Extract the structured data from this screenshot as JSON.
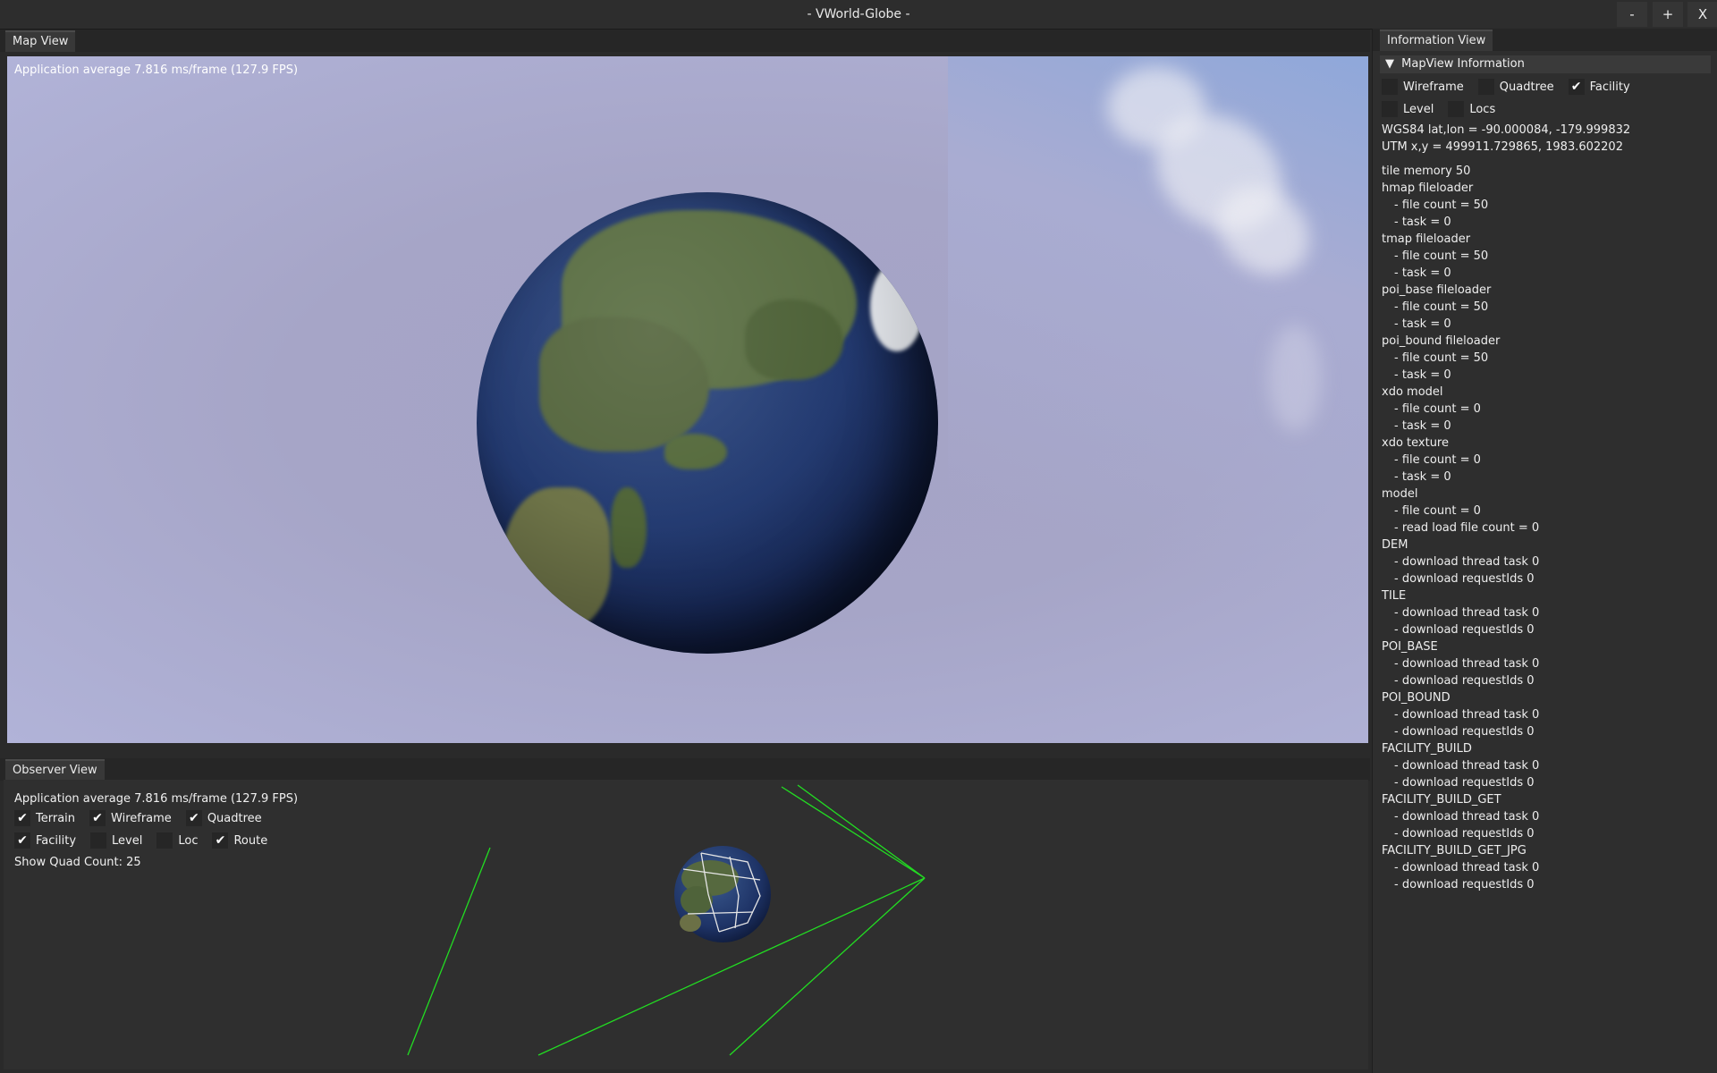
{
  "window": {
    "title": "- VWorld-Globe -",
    "minimize_label": "-",
    "maximize_label": "+",
    "close_label": "X"
  },
  "map_view": {
    "tab": "Map View",
    "fps_text": "Application average 7.816 ms/frame (127.9 FPS)"
  },
  "observer_view": {
    "tab": "Observer View",
    "fps_text": "Application average 7.816 ms/frame (127.9 FPS)",
    "checkboxes_row1": [
      {
        "label": "Terrain",
        "checked": true
      },
      {
        "label": "Wireframe",
        "checked": true
      },
      {
        "label": "Quadtree",
        "checked": true
      }
    ],
    "checkboxes_row2": [
      {
        "label": "Facility",
        "checked": true
      },
      {
        "label": "Level",
        "checked": false
      },
      {
        "label": "Loc",
        "checked": false
      },
      {
        "label": "Route",
        "checked": true
      }
    ],
    "quad_count_text": "Show Quad Count: 25"
  },
  "info_view": {
    "tab": "Information View",
    "section_title": "MapView Information",
    "checkboxes_row1": [
      {
        "label": "Wireframe",
        "checked": false
      },
      {
        "label": "Quadtree",
        "checked": false
      },
      {
        "label": "Facility",
        "checked": true
      }
    ],
    "checkboxes_row2": [
      {
        "label": "Level",
        "checked": false
      },
      {
        "label": "Locs",
        "checked": false
      }
    ],
    "wgs84": "WGS84 lat,lon = -90.000084, -179.999832",
    "utm": "UTM x,y = 499911.729865, 1983.602202",
    "lines": [
      {
        "text": "tile memory 50",
        "sub": false
      },
      {
        "text": "hmap fileloader",
        "sub": false
      },
      {
        "text": "- file count = 50",
        "sub": true
      },
      {
        "text": "- task = 0",
        "sub": true
      },
      {
        "text": "tmap fileloader",
        "sub": false
      },
      {
        "text": "- file count = 50",
        "sub": true
      },
      {
        "text": "- task = 0",
        "sub": true
      },
      {
        "text": "poi_base fileloader",
        "sub": false
      },
      {
        "text": "- file count = 50",
        "sub": true
      },
      {
        "text": "- task = 0",
        "sub": true
      },
      {
        "text": "poi_bound fileloader",
        "sub": false
      },
      {
        "text": "- file count = 50",
        "sub": true
      },
      {
        "text": "- task = 0",
        "sub": true
      },
      {
        "text": "xdo model",
        "sub": false
      },
      {
        "text": "- file count = 0",
        "sub": true
      },
      {
        "text": "- task = 0",
        "sub": true
      },
      {
        "text": "xdo texture",
        "sub": false
      },
      {
        "text": "- file count = 0",
        "sub": true
      },
      {
        "text": "- task = 0",
        "sub": true
      },
      {
        "text": "model",
        "sub": false
      },
      {
        "text": "- file count = 0",
        "sub": true
      },
      {
        "text": "- read load file count = 0",
        "sub": true
      },
      {
        "text": "DEM",
        "sub": false
      },
      {
        "text": "- download thread task 0",
        "sub": true
      },
      {
        "text": "- download requestIds 0",
        "sub": true
      },
      {
        "text": "TILE",
        "sub": false
      },
      {
        "text": "- download thread task 0",
        "sub": true
      },
      {
        "text": "- download requestIds 0",
        "sub": true
      },
      {
        "text": "POI_BASE",
        "sub": false
      },
      {
        "text": "- download thread task 0",
        "sub": true
      },
      {
        "text": "- download requestIds 0",
        "sub": true
      },
      {
        "text": "POI_BOUND",
        "sub": false
      },
      {
        "text": "- download thread task 0",
        "sub": true
      },
      {
        "text": "- download requestIds 0",
        "sub": true
      },
      {
        "text": "FACILITY_BUILD",
        "sub": false
      },
      {
        "text": "- download thread task 0",
        "sub": true
      },
      {
        "text": "- download requestIds 0",
        "sub": true
      },
      {
        "text": "FACILITY_BUILD_GET",
        "sub": false
      },
      {
        "text": "- download thread task 0",
        "sub": true
      },
      {
        "text": "- download requestIds 0",
        "sub": true
      },
      {
        "text": "FACILITY_BUILD_GET_JPG",
        "sub": false
      },
      {
        "text": "- download thread task 0",
        "sub": true
      },
      {
        "text": "- download requestIds 0",
        "sub": true
      }
    ]
  },
  "icons": {
    "check": "✔",
    "collapse_arrow": "▼"
  },
  "colors": {
    "route_lines": "#22dd22",
    "panel_bg": "#2e2e2e"
  }
}
